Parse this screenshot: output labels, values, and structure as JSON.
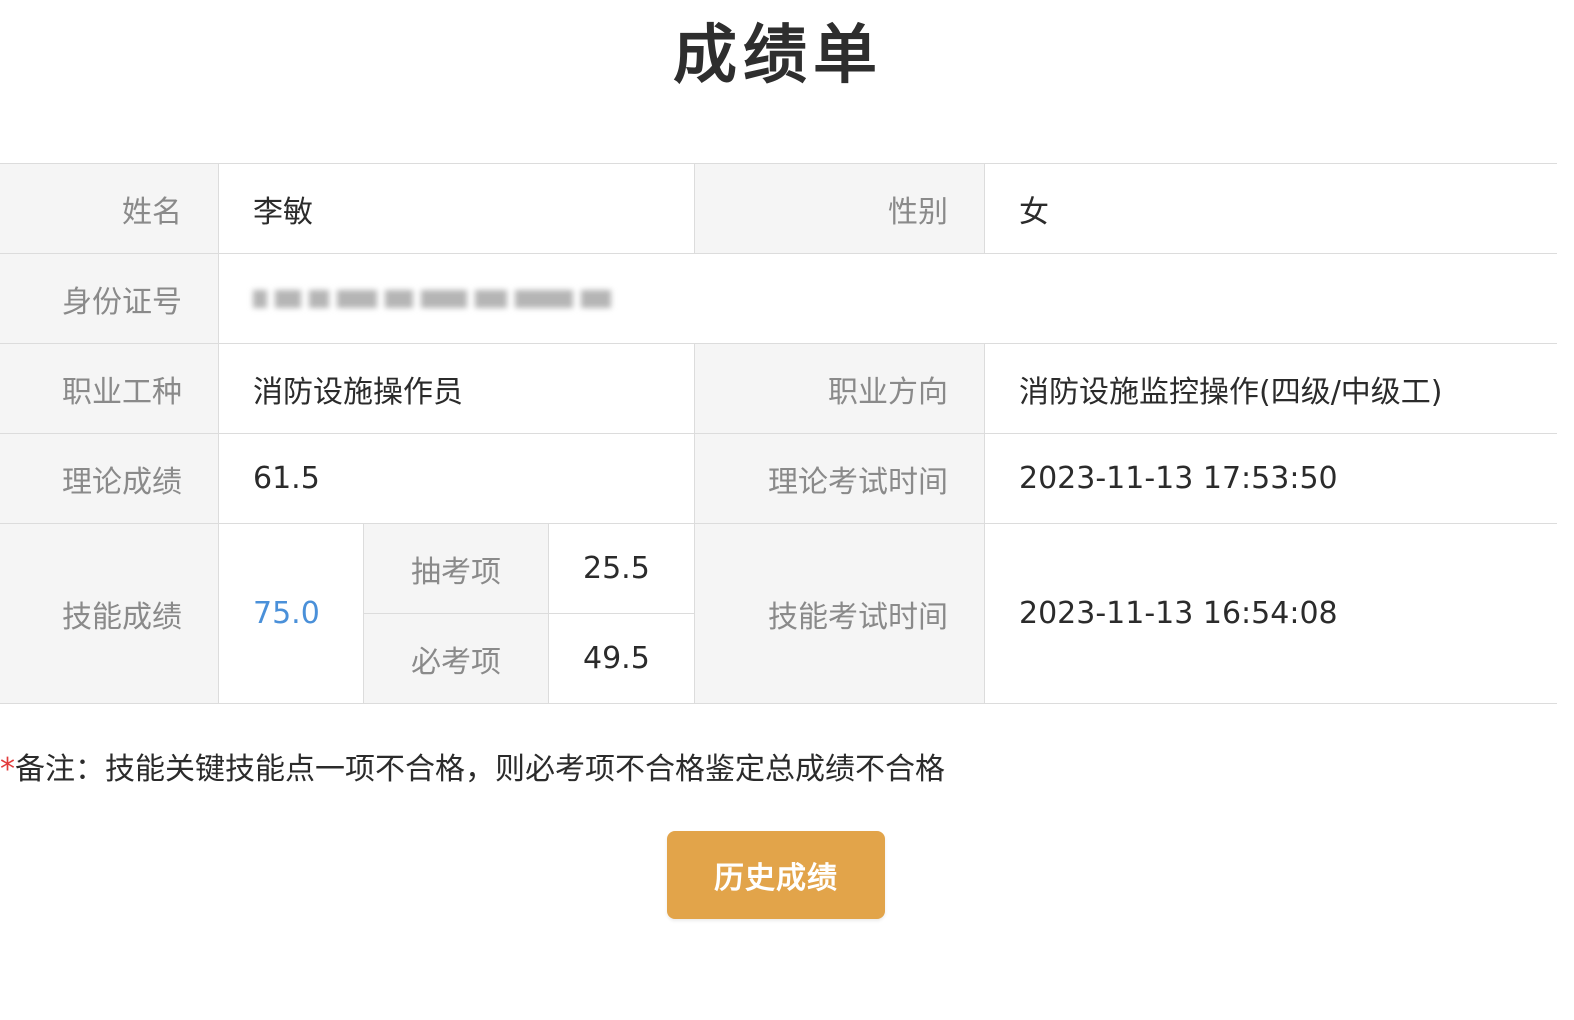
{
  "page": {
    "title": "成绩单"
  },
  "info": {
    "name_label": "姓名",
    "name_value": "李敏",
    "gender_label": "性别",
    "gender_value": "女",
    "id_label": "身份证号",
    "occupation_label": "职业工种",
    "occupation_value": "消防设施操作员",
    "direction_label": "职业方向",
    "direction_value": "消防设施监控操作(四级/中级工)",
    "theory_label": "理论成绩",
    "theory_value": "61.5",
    "theory_time_label": "理论考试时间",
    "theory_time_value": "2023-11-13 17:53:50",
    "skill_label": "技能成绩",
    "skill_value": "75.0",
    "random_label": "抽考项",
    "random_value": "25.5",
    "required_label": "必考项",
    "required_value": "49.5",
    "skill_time_label": "技能考试时间",
    "skill_time_value": "2023-11-13 16:54:08"
  },
  "note": {
    "asterisk": "*",
    "text": "备注：技能关键技能点一项不合格，则必考项不合格鉴定总成绩不合格"
  },
  "actions": {
    "history_button": "历史成绩"
  },
  "colors": {
    "accent_button": "#e2a44a",
    "skill_score": "#4a90d9",
    "asterisk": "#e23b3b",
    "label_bg": "#f5f5f5"
  }
}
